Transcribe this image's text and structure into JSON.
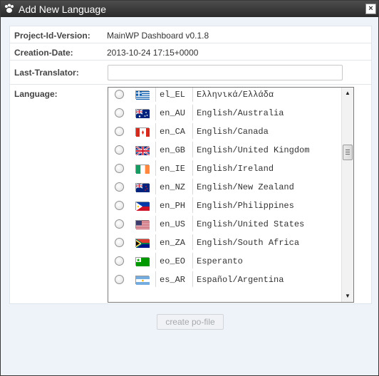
{
  "window": {
    "title": "Add New Language",
    "app_icon": "paw-icon",
    "close_glyph": "×"
  },
  "fields": {
    "project_label": "Project-Id-Version:",
    "project_value": "MainWP Dashboard v0.1.8",
    "creation_label": "Creation-Date:",
    "creation_value": "2013-10-24 17:15+0000",
    "translator_label": "Last-Translator:",
    "translator_value": "",
    "language_label": "Language:"
  },
  "languages": [
    {
      "code": "el_EL",
      "name": "Ελληνικά/Ελλάδα",
      "flag": "gr"
    },
    {
      "code": "en_AU",
      "name": "English/Australia",
      "flag": "au"
    },
    {
      "code": "en_CA",
      "name": "English/Canada",
      "flag": "ca"
    },
    {
      "code": "en_GB",
      "name": "English/United Kingdom",
      "flag": "gb"
    },
    {
      "code": "en_IE",
      "name": "English/Ireland",
      "flag": "ie"
    },
    {
      "code": "en_NZ",
      "name": "English/New Zealand",
      "flag": "nz"
    },
    {
      "code": "en_PH",
      "name": "English/Philippines",
      "flag": "ph"
    },
    {
      "code": "en_US",
      "name": "English/United States",
      "flag": "us"
    },
    {
      "code": "en_ZA",
      "name": "English/South Africa",
      "flag": "za"
    },
    {
      "code": "eo_EO",
      "name": "Esperanto",
      "flag": "eo"
    },
    {
      "code": "es_AR",
      "name": "Español/Argentina",
      "flag": "ar"
    }
  ],
  "button": {
    "create_label": "create po-file"
  },
  "scroll": {
    "up_glyph": "▲",
    "down_glyph": "▼"
  }
}
